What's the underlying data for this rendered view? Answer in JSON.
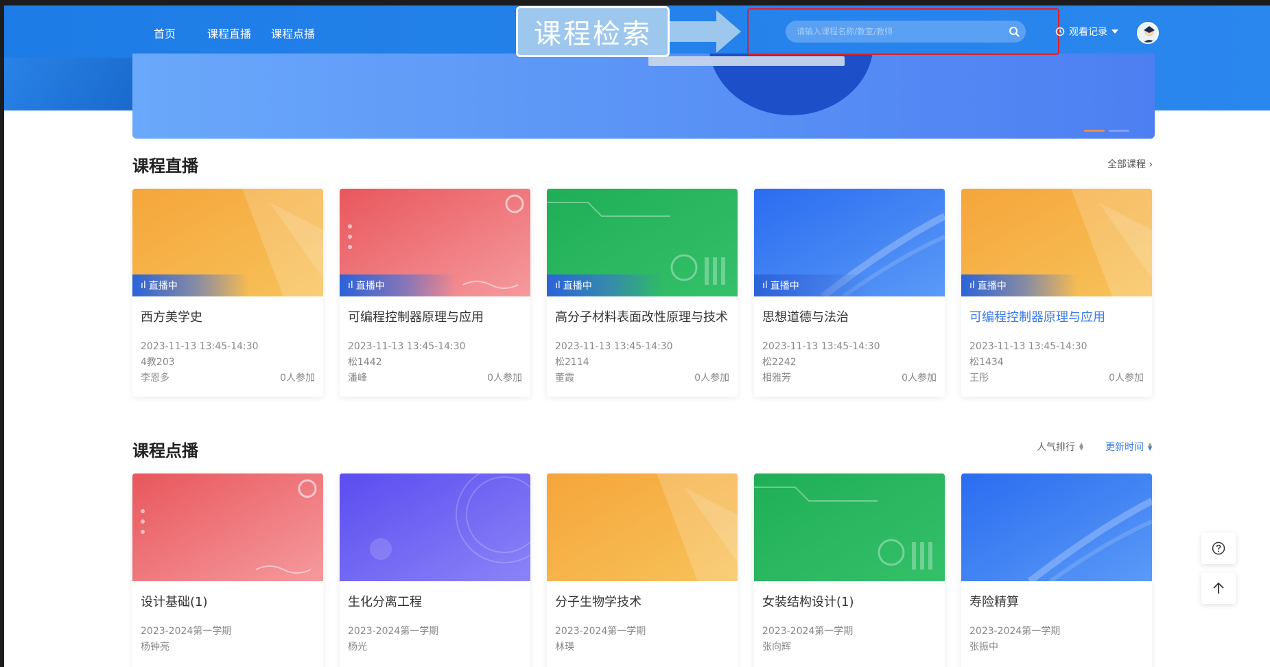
{
  "nav": {
    "items": [
      "首页",
      "课程直播",
      "课程点播"
    ],
    "annotation_label": "课程检索",
    "search_placeholder": "请输入课程名称/教室/教师",
    "history_label": "观看记录",
    "icons": [
      "search-icon",
      "history-icon",
      "caret-down-icon",
      "avatar"
    ]
  },
  "live": {
    "title": "课程直播",
    "all_courses": "全部课程",
    "badge": "直播中",
    "cards": [
      {
        "title": "西方美学史",
        "time": "2023-11-13 13:45-14:30",
        "room": "4教203",
        "teacher": "李恩多",
        "count": "0人参加",
        "theme": "orange"
      },
      {
        "title": "可编程控制器原理与应用",
        "time": "2023-11-13 13:45-14:30",
        "room": "松1442",
        "teacher": "潘峰",
        "count": "0人参加",
        "theme": "red"
      },
      {
        "title": "高分子材料表面改性原理与技术",
        "time": "2023-11-13 13:45-14:30",
        "room": "松2114",
        "teacher": "董霞",
        "count": "0人参加",
        "theme": "green"
      },
      {
        "title": "思想道德与法治",
        "time": "2023-11-13 13:45-14:30",
        "room": "松2242",
        "teacher": "相雅芳",
        "count": "0人参加",
        "theme": "blue"
      },
      {
        "title": "可编程控制器原理与应用",
        "time": "2023-11-13 13:45-14:30",
        "room": "松1434",
        "teacher": "王彤",
        "count": "0人参加",
        "theme": "orange",
        "highlighted": true
      }
    ]
  },
  "vod": {
    "title": "课程点播",
    "sort_popularity": "人气排行",
    "sort_updated": "更新时间",
    "cards": [
      {
        "title": "设计基础(1)",
        "term": "2023-2024第一学期",
        "teacher": "杨钟亮",
        "theme": "red"
      },
      {
        "title": "生化分离工程",
        "term": "2023-2024第一学期",
        "teacher": "杨光",
        "theme": "purple"
      },
      {
        "title": "分子生物学技术",
        "term": "2023-2024第一学期",
        "teacher": "林瑛",
        "theme": "orange"
      },
      {
        "title": "女装结构设计(1)",
        "term": "2023-2024第一学期",
        "teacher": "张向辉",
        "theme": "green"
      },
      {
        "title": "寿险精算",
        "term": "2023-2024第一学期",
        "teacher": "张振中",
        "theme": "blue"
      }
    ]
  },
  "colors": {
    "header_blue": "#1e7ce6",
    "highlight_text": "#3a7bec",
    "annotation_red": "#e01f2b"
  }
}
